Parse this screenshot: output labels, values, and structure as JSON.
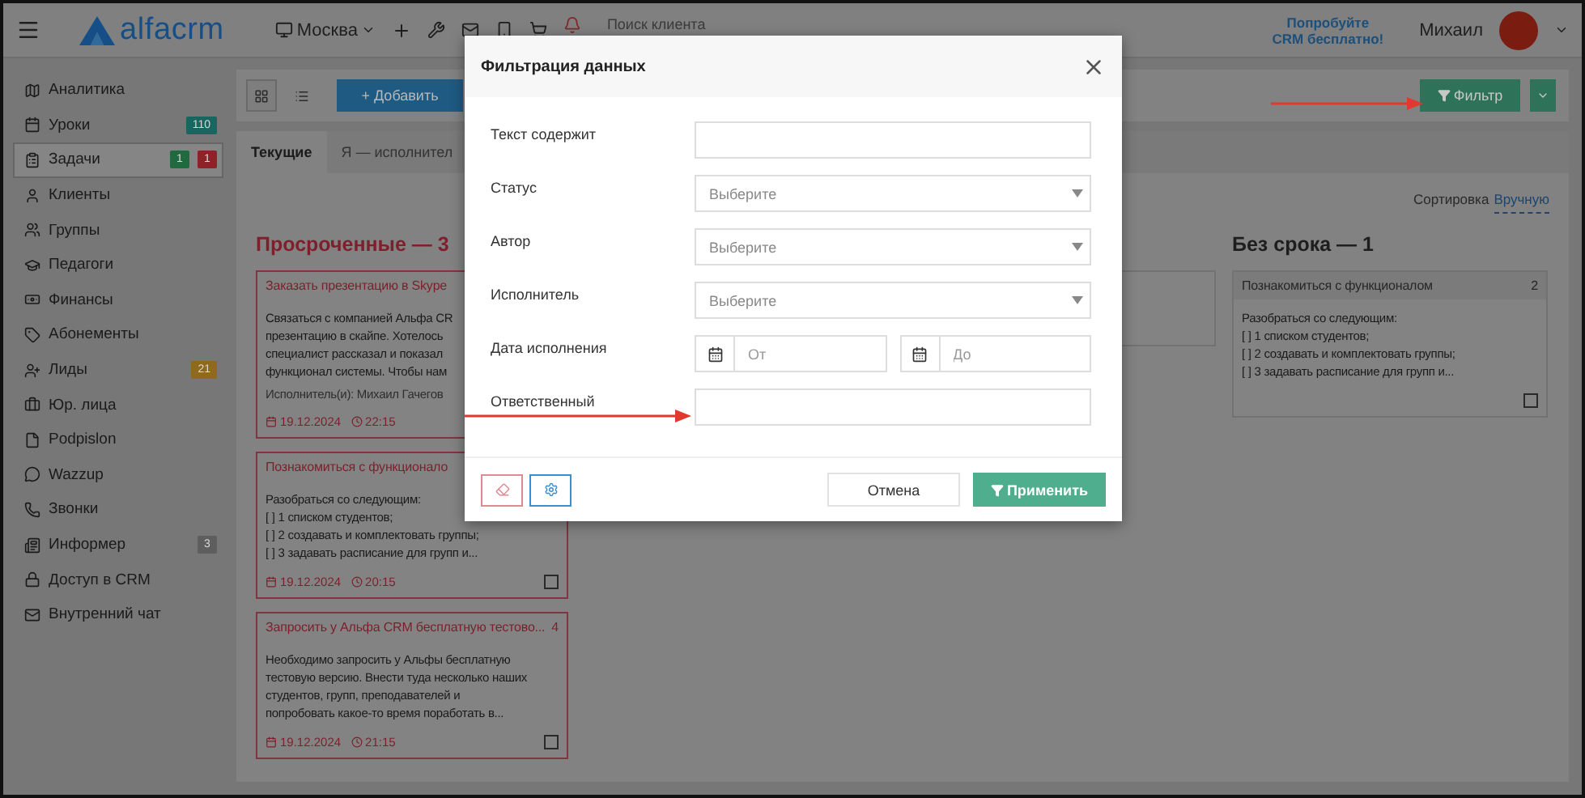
{
  "header": {
    "brand": "alfacrm",
    "branch": "Москва",
    "search_placeholder": "Поиск клиента",
    "promo": [
      "Попробуйте",
      "CRM бесплатно!"
    ],
    "user": "Михаил"
  },
  "sidebar": {
    "items": [
      {
        "label": "Аналитика",
        "selected": false
      },
      {
        "label": "Уроки",
        "selected": false,
        "badges": [
          {
            "text": "110",
            "color": "#17665f"
          }
        ]
      },
      {
        "label": "Задачи",
        "selected": true,
        "badges": [
          {
            "text": "1",
            "color": "#1f6a3e"
          },
          {
            "text": "1",
            "color": "#8e2228"
          }
        ]
      },
      {
        "label": "Клиенты",
        "selected": false
      },
      {
        "label": "Группы",
        "selected": false
      },
      {
        "label": "Педагоги",
        "selected": false
      },
      {
        "label": "Финансы",
        "selected": false
      },
      {
        "label": "Абонементы",
        "selected": false
      },
      {
        "label": "Лиды",
        "selected": false,
        "badges": [
          {
            "text": "21",
            "color": "#8f6a1c"
          }
        ]
      },
      {
        "label": "Юр. лица",
        "selected": false
      },
      {
        "label": "Podpislon",
        "selected": false
      },
      {
        "label": "Wazzup",
        "selected": false
      },
      {
        "label": "Звонки",
        "selected": false
      },
      {
        "label": "Информер",
        "selected": false,
        "badges": [
          {
            "text": "3",
            "color": "#5e5e5e"
          }
        ]
      },
      {
        "label": "Доступ в CRM",
        "selected": false
      },
      {
        "label": "Внутренний чат",
        "selected": false
      }
    ]
  },
  "toolbar": {
    "add_button": "+ Добавить",
    "filter_button": "Фильтр"
  },
  "tabs": [
    {
      "label": "Текущие",
      "selected": true
    },
    {
      "label": "Я — исполнител",
      "selected": false
    }
  ],
  "sort": {
    "label": "Сортировка",
    "value": "Вручную"
  },
  "columns": [
    {
      "title": "Просроченные — 3",
      "kind": "overdue",
      "cards": [
        {
          "title": "Заказать презентацию в Skype",
          "lines": [
            "Связаться с компанией Альфа CR",
            "презентацию в скайпе. Хотелось",
            "специалист рассказал и показал",
            "функционал системы. Чтобы нам"
          ],
          "executor": "Исполнитель(и): Михаил Гачегов",
          "date": "19.12.2024",
          "time": "22:15"
        },
        {
          "title": "Познакомиться с функционало",
          "lines": [
            "Разобраться со следующим:",
            "[ ] 1 списком студентов;",
            "[ ] 2 создавать и комплектовать группы;",
            "[ ] 3 задавать расписание для групп и..."
          ],
          "date": "19.12.2024",
          "time": "20:15",
          "checked": false
        },
        {
          "title": "Запросить у Альфа CRM бесплатную тестово...",
          "number": "4",
          "lines": [
            "Необходимо запросить у Альфы бесплатную",
            "тестовую версию. Внести туда несколько наших",
            "студентов, групп, преподавателей и",
            "попробовать какое-то время поработать в..."
          ],
          "date": "19.12.2024",
          "time": "21:15",
          "checked": false
        }
      ]
    },
    {
      "title": "Без срока — 1",
      "kind": "plain",
      "cards": [
        {
          "title": "Познакомиться с функционалом",
          "number": "2",
          "lines": [
            "Разобраться со следующим:",
            "[ ] 1 списком студентов;",
            "[ ] 2 создавать и комплектовать группы;",
            "[ ] 3 задавать расписание для групп и..."
          ],
          "checked": false
        }
      ]
    }
  ],
  "modal": {
    "title": "Фильтрация данных",
    "fields": [
      {
        "label": "Текст содержит",
        "kind": "text"
      },
      {
        "label": "Статус",
        "kind": "select",
        "placeholder": "Выберите"
      },
      {
        "label": "Автор",
        "kind": "select",
        "placeholder": "Выберите"
      },
      {
        "label": "Исполнитель",
        "kind": "select",
        "placeholder": "Выберите"
      },
      {
        "label": "Дата исполнения",
        "kind": "daterange",
        "placeholders": [
          "От",
          "До"
        ]
      },
      {
        "label": "Ответственный",
        "kind": "text"
      }
    ],
    "cancel_button": "Отмена",
    "apply_button": "Применить"
  }
}
